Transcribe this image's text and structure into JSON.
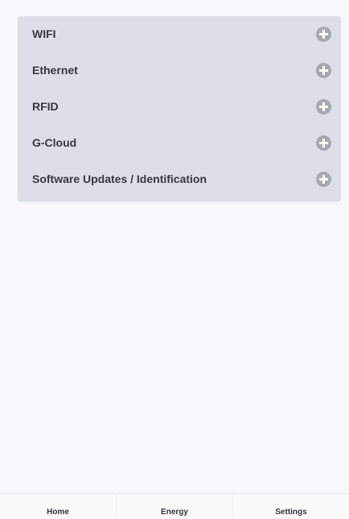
{
  "settings_menu": {
    "items": [
      {
        "label": "WIFI",
        "icon": "plus-circle-icon"
      },
      {
        "label": "Ethernet",
        "icon": "plus-circle-icon"
      },
      {
        "label": "RFID",
        "icon": "plus-circle-icon"
      },
      {
        "label": "G-Cloud",
        "icon": "plus-circle-icon"
      },
      {
        "label": "Software Updates / Identification",
        "icon": "plus-circle-icon"
      }
    ]
  },
  "tab_bar": {
    "tabs": [
      {
        "label": "Home"
      },
      {
        "label": "Energy"
      },
      {
        "label": "Settings"
      }
    ]
  },
  "colors": {
    "panel_background": "#dcdfe8",
    "page_background": "#f8f8fa",
    "icon_color": "#a6a9b1",
    "text_color": "#35383d"
  }
}
